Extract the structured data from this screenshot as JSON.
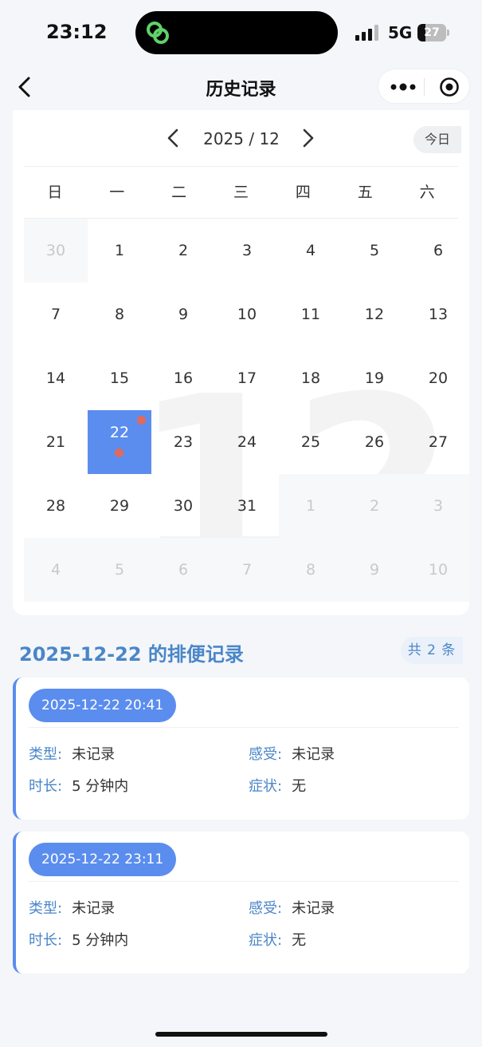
{
  "status": {
    "time": "23:12",
    "network": "5G",
    "battery": "27",
    "battery_level": 0.27
  },
  "nav": {
    "title": "历史记录"
  },
  "calendar": {
    "month_label": "2025 / 12",
    "today_label": "今日",
    "watermark": "12",
    "weekdays": [
      "日",
      "一",
      "二",
      "三",
      "四",
      "五",
      "六"
    ],
    "days": [
      {
        "d": "30",
        "other": true
      },
      {
        "d": "1"
      },
      {
        "d": "2"
      },
      {
        "d": "3"
      },
      {
        "d": "4"
      },
      {
        "d": "5"
      },
      {
        "d": "6"
      },
      {
        "d": "7"
      },
      {
        "d": "8"
      },
      {
        "d": "9"
      },
      {
        "d": "10"
      },
      {
        "d": "11"
      },
      {
        "d": "12"
      },
      {
        "d": "13"
      },
      {
        "d": "14"
      },
      {
        "d": "15"
      },
      {
        "d": "16"
      },
      {
        "d": "17"
      },
      {
        "d": "18"
      },
      {
        "d": "19"
      },
      {
        "d": "20"
      },
      {
        "d": "21"
      },
      {
        "d": "22",
        "selected": true,
        "dots": 2
      },
      {
        "d": "23"
      },
      {
        "d": "24"
      },
      {
        "d": "25"
      },
      {
        "d": "26"
      },
      {
        "d": "27"
      },
      {
        "d": "28"
      },
      {
        "d": "29"
      },
      {
        "d": "30"
      },
      {
        "d": "31"
      },
      {
        "d": "1",
        "other": true
      },
      {
        "d": "2",
        "other": true
      },
      {
        "d": "3",
        "other": true
      },
      {
        "d": "4",
        "other": true
      },
      {
        "d": "5",
        "other": true
      },
      {
        "d": "6",
        "other": true
      },
      {
        "d": "7",
        "other": true
      },
      {
        "d": "8",
        "other": true
      },
      {
        "d": "9",
        "other": true
      },
      {
        "d": "10",
        "other": true
      }
    ]
  },
  "section": {
    "title": "2025-12-22 的排便记录",
    "count": "共 2 条"
  },
  "labels": {
    "type": "类型:",
    "feeling": "感受:",
    "duration": "时长:",
    "symptom": "症状:"
  },
  "records": [
    {
      "time": "2025-12-22 20:41",
      "type": "未记录",
      "feeling": "未记录",
      "duration": "5 分钟内",
      "symptom": "无"
    },
    {
      "time": "2025-12-22 23:11",
      "type": "未记录",
      "feeling": "未记录",
      "duration": "5 分钟内",
      "symptom": "无"
    }
  ],
  "colors": {
    "accent": "#5b8def",
    "label": "#4a86c8",
    "dot": "#e06a5c",
    "island_icon": "#5fd16a"
  }
}
